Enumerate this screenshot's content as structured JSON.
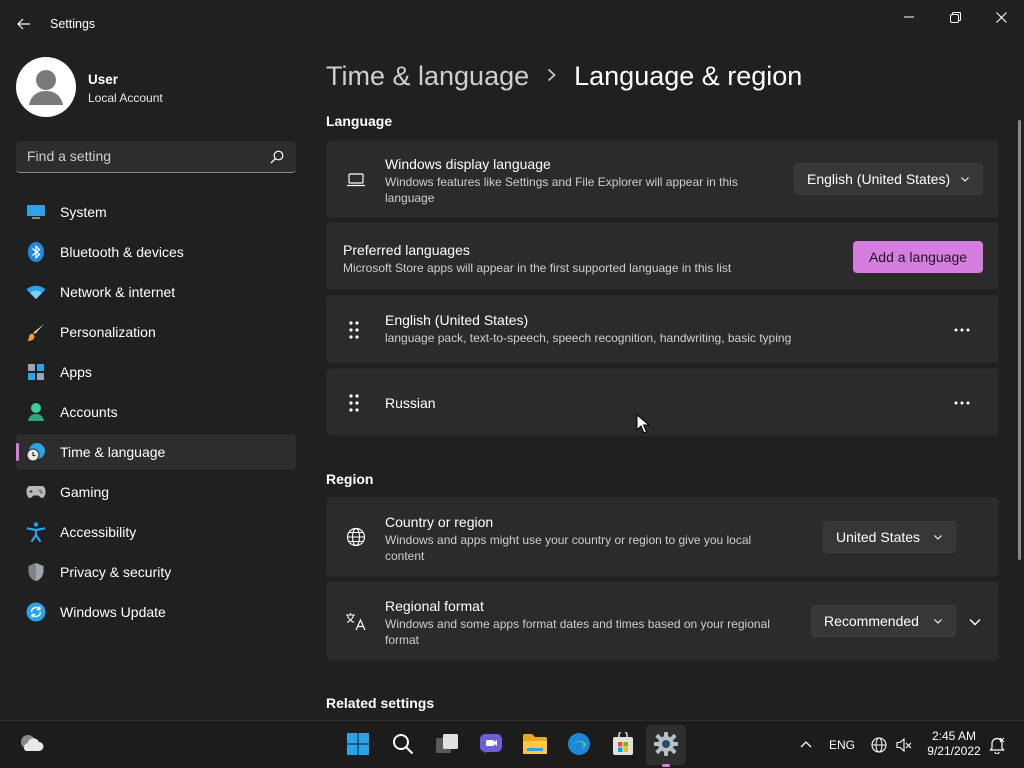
{
  "window": {
    "title": "Settings"
  },
  "profile": {
    "name": "User",
    "account_type": "Local Account"
  },
  "search": {
    "placeholder": "Find a setting"
  },
  "nav": {
    "items": [
      {
        "label": "System",
        "icon": "system-icon"
      },
      {
        "label": "Bluetooth & devices",
        "icon": "bluetooth-icon"
      },
      {
        "label": "Network & internet",
        "icon": "wifi-icon"
      },
      {
        "label": "Personalization",
        "icon": "brush-icon"
      },
      {
        "label": "Apps",
        "icon": "apps-icon"
      },
      {
        "label": "Accounts",
        "icon": "accounts-icon"
      },
      {
        "label": "Time & language",
        "icon": "time-language-icon",
        "active": true
      },
      {
        "label": "Gaming",
        "icon": "gamepad-icon"
      },
      {
        "label": "Accessibility",
        "icon": "accessibility-icon"
      },
      {
        "label": "Privacy & security",
        "icon": "shield-icon"
      },
      {
        "label": "Windows Update",
        "icon": "update-icon"
      }
    ]
  },
  "breadcrumb": {
    "parent": "Time & language",
    "separator": ">",
    "current": "Language & region"
  },
  "language_section": {
    "title": "Language",
    "display_language": {
      "title": "Windows display language",
      "desc_line1": "Windows features like Settings and File Explorer will appear in this",
      "desc_line2": "language",
      "value": "English (United States)"
    },
    "preferred": {
      "title": "Preferred languages",
      "desc": "Microsoft Store apps will appear in the first supported language in this list",
      "add_button": "Add a language"
    },
    "languages": [
      {
        "name": "English (United States)",
        "features": "language pack, text-to-speech, speech recognition, handwriting, basic typing"
      },
      {
        "name": "Russian",
        "features": ""
      }
    ]
  },
  "region_section": {
    "title": "Region",
    "country": {
      "title": "Country or region",
      "desc_line1": "Windows and apps might use your country or region to give you local",
      "desc_line2": "content",
      "value": "United States"
    },
    "format": {
      "title": "Regional format",
      "desc_line1": "Windows and some apps format dates and times based on your regional",
      "desc_line2": "format",
      "value": "Recommended"
    }
  },
  "related": {
    "title": "Related settings"
  },
  "taskbar": {
    "input_language": "ENG",
    "time": "2:45 AM",
    "date": "9/21/2022"
  },
  "colors": {
    "accent": "#d67ee0",
    "background": "#202020",
    "card": "#2b2b2b"
  }
}
